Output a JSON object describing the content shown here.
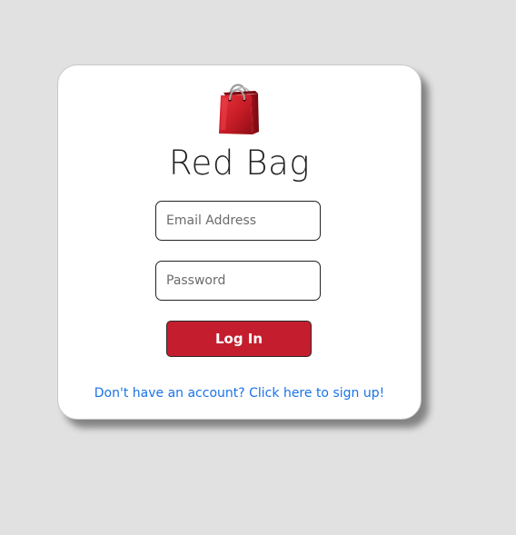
{
  "app": {
    "title": "Red Bag",
    "logo_icon": "shopping-bag-icon",
    "brand_color": "#c41e2e"
  },
  "login_form": {
    "email_placeholder": "Email Address",
    "email_value": "",
    "password_placeholder": "Password",
    "password_value": "",
    "submit_label": "Log In"
  },
  "footer": {
    "signup_text": "Don't have an account? Click here to sign up!",
    "link_color": "#1a73e8"
  }
}
